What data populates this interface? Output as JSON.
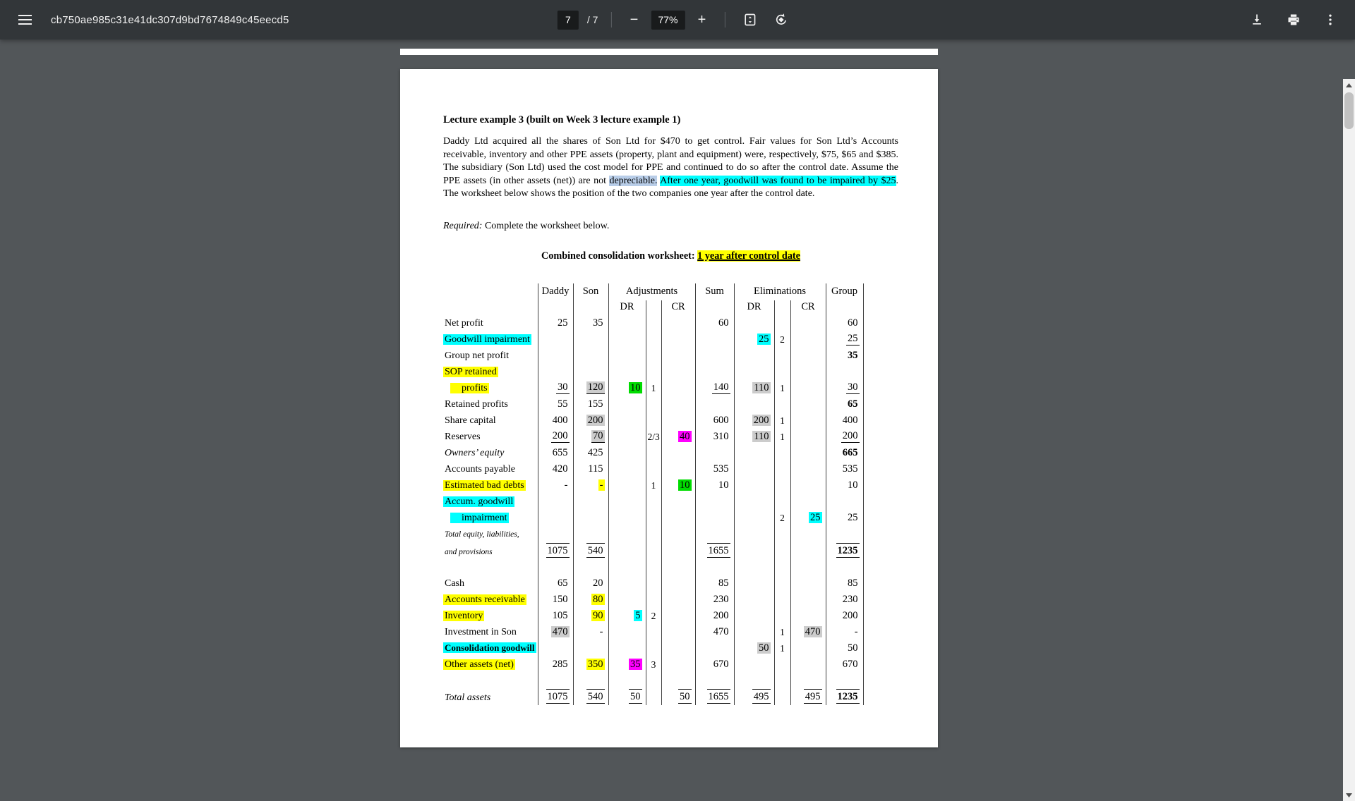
{
  "toolbar": {
    "title": "cb750ae985c31e41dc307d9bd7674849c45eecd5",
    "page_current": "7",
    "page_total": "/ 7",
    "zoom_out_label": "−",
    "zoom_level": "77%",
    "zoom_in_label": "+"
  },
  "icons": {
    "menu": "hamburger",
    "fit": "fit-to-page",
    "rotate": "rotate-counterclockwise",
    "download": "download-arrow",
    "print": "printer",
    "more": "three-dot-menu",
    "scroll_up": "up-arrow",
    "scroll_down": "down-arrow"
  },
  "document": {
    "heading": "Lecture example 3 (built on Week 3 lecture example 1)",
    "paragraph": [
      {
        "t": "Daddy Ltd acquired all the shares of Son Ltd for $470 to get control. Fair values for Son Ltd’s Accounts receivable, inventory and other PPE assets (property, plant and equipment) were, respectively, $75, $65 and $385. The subsidiary (Son Ltd) used the cost model for PPE and continued to do so after the control date. Assume the PPE assets (in other assets (net)) are not "
      },
      {
        "t": "depreciable.",
        "hl": "selection"
      },
      {
        "t": " "
      },
      {
        "t": "After one year, goodwill was found to be impaired by $25",
        "hl": "cyan"
      },
      {
        "t": ". The worksheet below shows the position of the two companies one year after the control date."
      }
    ],
    "required_label": "Required:",
    "required_text": " Complete the worksheet below.",
    "worksheet_title": [
      {
        "t": "Combined consolidation worksheet: ",
        "b": true
      },
      {
        "t": "1 year after control date",
        "b": true,
        "u": true,
        "hl": "yellow"
      }
    ]
  },
  "table": {
    "headers": {
      "daddy": "Daddy",
      "son": "Son",
      "adjustments": "Adjustments",
      "sum": "Sum",
      "eliminations": "Eliminations",
      "group": "Group",
      "dr": "DR",
      "cr": "CR"
    },
    "rows": [
      {
        "label": {
          "t": "Net profit"
        },
        "cells": {
          "daddy": {
            "t": "25"
          },
          "son": {
            "t": "35"
          },
          "sum": {
            "t": "60"
          },
          "group": {
            "t": "60"
          }
        }
      },
      {
        "label": {
          "t": "Goodwill impairment",
          "hl": "cyan"
        },
        "cells": {
          "edr": {
            "t": "25",
            "hl": "cyan"
          },
          "eref": {
            "t": "2"
          },
          "group": {
            "t": "25",
            "u": true
          }
        }
      },
      {
        "label": {
          "t": "Group net profit"
        },
        "cells": {
          "group": {
            "t": "35",
            "b": true
          }
        }
      },
      {
        "label": {
          "t": "SOP retained",
          "hl": "yellow"
        },
        "cells": {}
      },
      {
        "label": {
          "t": "profits",
          "hl": "yellow",
          "indent": true
        },
        "cells": {
          "daddy": {
            "t": "30",
            "u": true
          },
          "son": {
            "t": "120",
            "hl": "gray",
            "u": true
          },
          "adr": {
            "t": "10",
            "hl": "green"
          },
          "aref": {
            "t": "1"
          },
          "sum": {
            "t": "140",
            "u": true
          },
          "edr": {
            "t": "110",
            "hl": "gray"
          },
          "eref": {
            "t": "1"
          },
          "group": {
            "t": "30",
            "u": true
          }
        }
      },
      {
        "label": {
          "t": "Retained profits"
        },
        "cells": {
          "daddy": {
            "t": "55"
          },
          "son": {
            "t": "155"
          },
          "group": {
            "t": "65",
            "b": true
          }
        }
      },
      {
        "label": {
          "t": "Share capital"
        },
        "cells": {
          "daddy": {
            "t": "400"
          },
          "son": {
            "t": "200",
            "hl": "gray"
          },
          "sum": {
            "t": "600"
          },
          "edr": {
            "t": "200",
            "hl": "gray"
          },
          "eref": {
            "t": "1"
          },
          "group": {
            "t": "400"
          }
        }
      },
      {
        "label": {
          "t": "Reserves"
        },
        "cells": {
          "daddy": {
            "t": "200",
            "u": true
          },
          "son": {
            "t": "70",
            "hl": "gray",
            "u": true
          },
          "aref": {
            "t": "2/3"
          },
          "acr": {
            "t": "40",
            "hl": "magenta"
          },
          "sum": {
            "t": "310"
          },
          "edr": {
            "t": "110",
            "hl": "gray"
          },
          "eref": {
            "t": "1"
          },
          "group": {
            "t": "200",
            "u": true
          }
        }
      },
      {
        "label": {
          "t": "Owners’ equity",
          "i": true
        },
        "cells": {
          "daddy": {
            "t": "655"
          },
          "son": {
            "t": "425"
          },
          "group": {
            "t": "665",
            "b": true
          }
        }
      },
      {
        "label": {
          "t": "Accounts payable"
        },
        "cells": {
          "daddy": {
            "t": "420"
          },
          "son": {
            "t": "115"
          },
          "sum": {
            "t": "535"
          },
          "group": {
            "t": "535"
          }
        }
      },
      {
        "label": {
          "t": "Estimated bad debts",
          "hl": "yellow"
        },
        "cells": {
          "daddy": {
            "t": "-"
          },
          "son": {
            "t": "-",
            "hl": "yellow"
          },
          "aref": {
            "t": "1"
          },
          "acr": {
            "t": "10",
            "hl": "green"
          },
          "sum": {
            "t": "10"
          },
          "group": {
            "t": "10"
          }
        }
      },
      {
        "label": {
          "t": "Accum. goodwill",
          "hl": "cyan"
        },
        "cells": {}
      },
      {
        "label": {
          "t": "impairment",
          "hl": "cyan",
          "indent": true
        },
        "cells": {
          "eref": {
            "t": "2"
          },
          "ecr": {
            "t": "25",
            "hl": "cyan"
          },
          "group": {
            "t": "25"
          }
        }
      },
      {
        "label": {
          "t": "Total equity, liabilities,",
          "small": true
        },
        "cells": {}
      },
      {
        "label": {
          "t": "and provisions",
          "small": true
        },
        "cells": {
          "daddy": {
            "t": "1075",
            "ou": true
          },
          "son": {
            "t": "540",
            "ou": true
          },
          "sum": {
            "t": "1655",
            "ou": true
          },
          "group": {
            "t": "1235",
            "b": true,
            "ou": true
          }
        }
      },
      {
        "spacer": true
      },
      {
        "label": {
          "t": "Cash"
        },
        "cells": {
          "daddy": {
            "t": "65"
          },
          "son": {
            "t": "20"
          },
          "sum": {
            "t": "85"
          },
          "group": {
            "t": "85"
          }
        }
      },
      {
        "label": {
          "t": "Accounts receivable",
          "hl": "yellow"
        },
        "cells": {
          "daddy": {
            "t": "150"
          },
          "son": {
            "t": "80",
            "hl": "yellow"
          },
          "sum": {
            "t": "230"
          },
          "group": {
            "t": "230"
          }
        }
      },
      {
        "label": {
          "t": "Inventory",
          "hl": "yellow"
        },
        "cells": {
          "daddy": {
            "t": "105"
          },
          "son": {
            "t": "90",
            "hl": "yellow"
          },
          "adr": {
            "t": "5",
            "hl": "cyan"
          },
          "aref": {
            "t": "2"
          },
          "sum": {
            "t": "200"
          },
          "group": {
            "t": "200"
          }
        }
      },
      {
        "label": {
          "t": "Investment in Son"
        },
        "cells": {
          "daddy": {
            "t": "470",
            "hl": "gray"
          },
          "son": {
            "t": "-"
          },
          "sum": {
            "t": "470"
          },
          "eref": {
            "t": "1"
          },
          "ecr": {
            "t": "470",
            "hl": "gray"
          },
          "group": {
            "t": "-"
          }
        }
      },
      {
        "label": {
          "t": "Consolidation goodwill",
          "hl": "cyan",
          "b": true
        },
        "cells": {
          "edr": {
            "t": "50",
            "hl": "gray"
          },
          "eref": {
            "t": "1"
          },
          "group": {
            "t": "50"
          }
        }
      },
      {
        "label": {
          "t": "Other assets (net)",
          "hl": "yellow"
        },
        "cells": {
          "daddy": {
            "t": "285"
          },
          "son": {
            "t": "350",
            "hl": "yellow"
          },
          "adr": {
            "t": "35",
            "hl": "magenta"
          },
          "aref": {
            "t": "3"
          },
          "sum": {
            "t": "670"
          },
          "group": {
            "t": "670"
          }
        }
      },
      {
        "spacer": true
      },
      {
        "label": {
          "t": "Total assets",
          "i": true
        },
        "cells": {
          "daddy": {
            "t": "1075",
            "ou": true
          },
          "son": {
            "t": "540",
            "ou": true
          },
          "adr": {
            "t": "50",
            "ou": true
          },
          "acr": {
            "t": "50",
            "ou": true
          },
          "sum": {
            "t": "1655",
            "ou": true
          },
          "edr": {
            "t": "495",
            "ou": true
          },
          "ecr": {
            "t": "495",
            "ou": true
          },
          "group": {
            "t": "1235",
            "b": true,
            "ou": true
          }
        }
      }
    ]
  },
  "colors": {
    "toolbar_bg": "#323639",
    "viewer_bg": "#525659",
    "page_bg": "#ffffff",
    "highlight_yellow": "#ffff00",
    "highlight_cyan": "#00ffff",
    "highlight_green": "#00dc00",
    "highlight_magenta": "#ff00ff",
    "highlight_gray": "#cccccc",
    "text_selection_blue": "#b8cde8"
  }
}
